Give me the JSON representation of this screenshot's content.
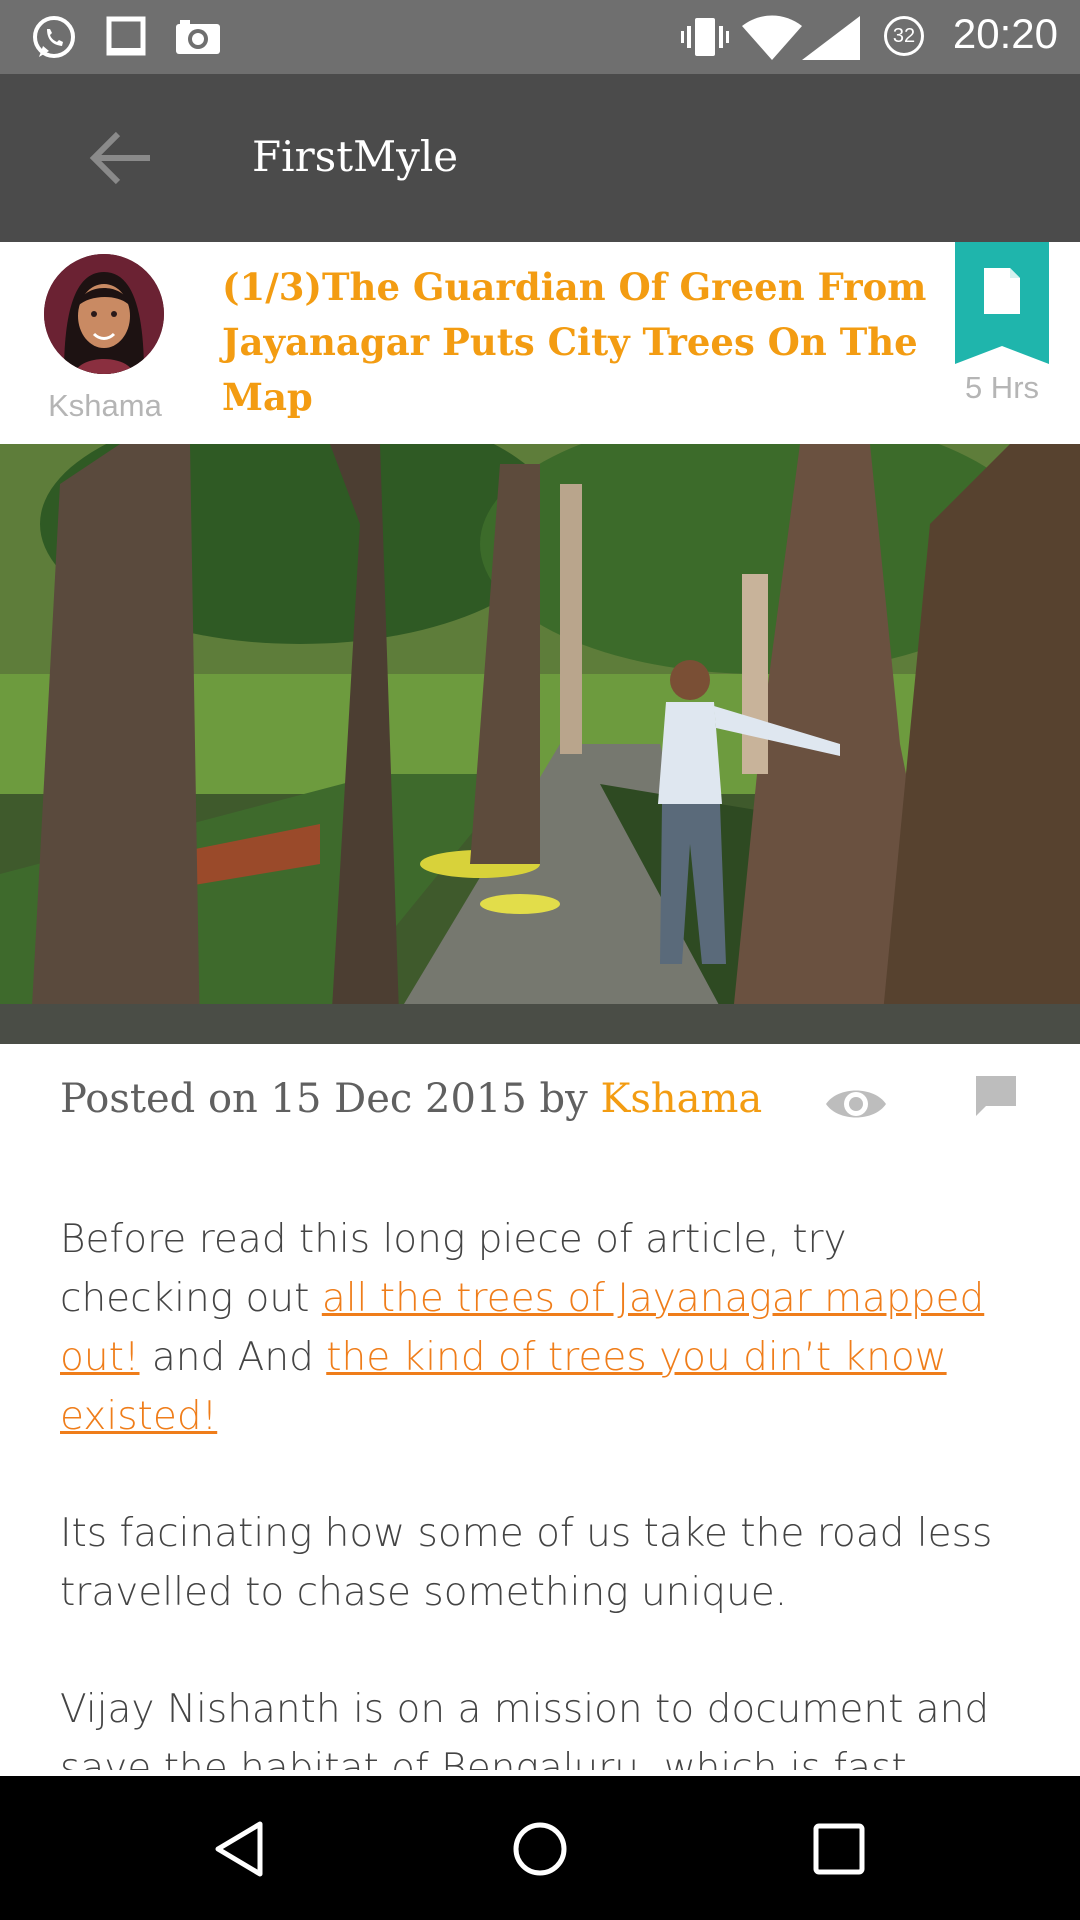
{
  "status_bar": {
    "time": "20:20",
    "battery_level": "32",
    "icons": [
      "whatsapp-icon",
      "tablet-icon",
      "camera-icon",
      "vibrate-icon",
      "wifi-icon",
      "signal-icon",
      "battery-icon"
    ]
  },
  "app_bar": {
    "title": "FirstMyle",
    "back_icon": "arrow-left-icon"
  },
  "post": {
    "author_short": "Kshama",
    "title": "(1/3)The Guardian Of Green From Jayanagar Puts City Trees On The Map",
    "age": "5 Hrs",
    "badge_icon": "document-icon",
    "meta_prefix": "Posted on 15 Dec 2015 by",
    "meta_author": "Kshama",
    "views_icon": "eye-icon",
    "comments_icon": "comment-icon"
  },
  "article": {
    "p1_before": "Before read this long piece of article, try checking out ",
    "p1_link1": "all the trees of Jayanagar mapped out!",
    "p1_middle": " and And ",
    "p1_link2": "the kind of trees you din’t know existed!",
    "p2": "Its facinating how some of us take the road less travelled to chase something unique.",
    "p3": "Vijay Nishanth is on a mission to document and save the habitat of Bengaluru, which is fast losing its green cover in the name of development and rapid urbanisation."
  },
  "nav_bar": {
    "back_icon": "nav-back-icon",
    "home_icon": "nav-home-icon",
    "recents_icon": "nav-recents-icon"
  },
  "colors": {
    "accent": "#f39c12",
    "link": "#ef7d1a",
    "badge": "#1fb5ac",
    "app_bar": "#4b4b4b",
    "status_bar": "#6f6f6f"
  }
}
